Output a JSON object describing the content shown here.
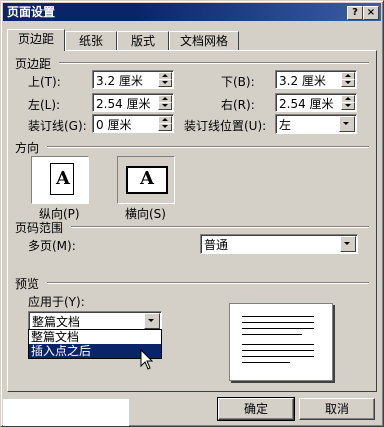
{
  "window": {
    "title": "页面设置",
    "help_glyph": "?",
    "close_glyph": "×"
  },
  "tabs": [
    {
      "label": "页边距",
      "active": true
    },
    {
      "label": "纸张",
      "active": false
    },
    {
      "label": "版式",
      "active": false
    },
    {
      "label": "文档网格",
      "active": false
    }
  ],
  "margins": {
    "section_label": "页边距",
    "top": {
      "label": "上(T):",
      "value": "3.2 厘米"
    },
    "bottom": {
      "label": "下(B):",
      "value": "3.2 厘米"
    },
    "left": {
      "label": "左(L):",
      "value": "2.54 厘米"
    },
    "right": {
      "label": "右(R):",
      "value": "2.54 厘米"
    },
    "gutter": {
      "label": "装订线(G):",
      "value": "0 厘米"
    },
    "gutter_position": {
      "label": "装订线位置(U):",
      "value": "左"
    }
  },
  "orientation": {
    "section_label": "方向",
    "portrait": {
      "label": "纵向(P)",
      "glyph": "A"
    },
    "landscape": {
      "label": "横向(S)",
      "glyph": "A",
      "selected": true
    }
  },
  "pages": {
    "section_label": "页码范围",
    "multiple_label": "多页(M):",
    "multiple_value": "普通"
  },
  "preview": {
    "section_label": "预览",
    "apply_label": "应用于(Y):",
    "apply_value": "整篇文档",
    "apply_options": [
      "整篇文档",
      "插入点之后"
    ],
    "highlighted_index": 1
  },
  "buttons": {
    "ok": "确定",
    "cancel": "取消"
  },
  "colors": {
    "titlebar": "#0a246a",
    "face": "#d4d0c8",
    "highlight": "#0a246a"
  }
}
